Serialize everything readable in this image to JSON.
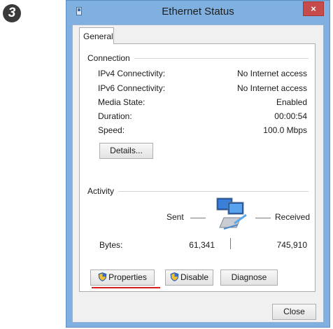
{
  "step_badge": "3",
  "window": {
    "title": "Ethernet Status",
    "close_glyph": "×"
  },
  "tabs": [
    {
      "label": "General"
    }
  ],
  "connection": {
    "group_title": "Connection",
    "rows": [
      {
        "label": "IPv4 Connectivity:",
        "value": "No Internet access"
      },
      {
        "label": "IPv6 Connectivity:",
        "value": "No Internet access"
      },
      {
        "label": "Media State:",
        "value": "Enabled"
      },
      {
        "label": "Duration:",
        "value": "00:00:54"
      },
      {
        "label": "Speed:",
        "value": "100.0 Mbps"
      }
    ],
    "details_button": "Details..."
  },
  "activity": {
    "group_title": "Activity",
    "sent_label": "Sent",
    "received_label": "Received",
    "bytes_label": "Bytes:",
    "bytes_sent": "61,341",
    "bytes_received": "745,910",
    "network_icon": "network-computers-icon"
  },
  "buttons": {
    "properties": "Properties",
    "disable": "Disable",
    "diagnose": "Diagnose",
    "close": "Close"
  },
  "colors": {
    "highlight_underline": "#d62020",
    "frame": "#7fb0e0",
    "close_button": "#c74b4b"
  }
}
